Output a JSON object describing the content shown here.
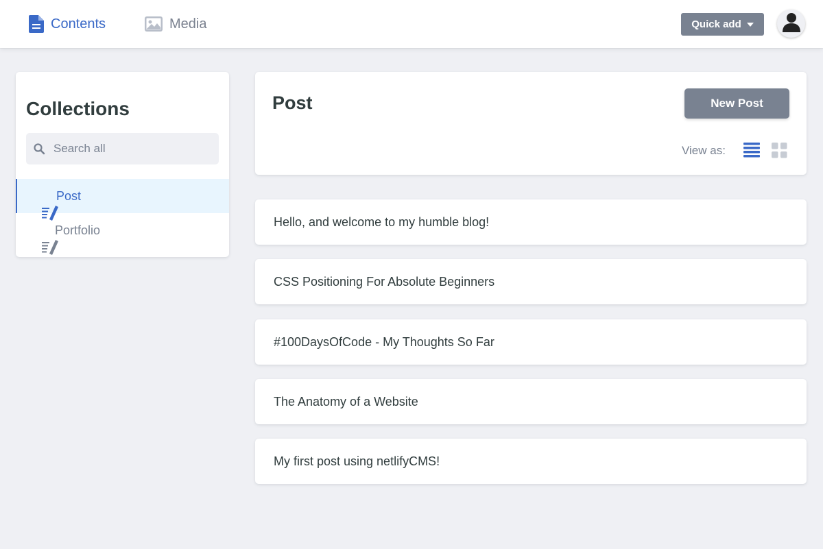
{
  "topbar": {
    "nav": [
      {
        "label": "Contents",
        "icon": "document-icon",
        "active": true
      },
      {
        "label": "Media",
        "icon": "image-icon",
        "active": false
      }
    ],
    "quick_add_label": "Quick add",
    "avatar_icon": "user-avatar-icon"
  },
  "sidebar": {
    "title": "Collections",
    "search_placeholder": "Search all",
    "collections": [
      {
        "label": "Post",
        "icon": "write-icon",
        "active": true
      },
      {
        "label": "Portfolio",
        "icon": "write-icon",
        "active": false
      }
    ]
  },
  "main": {
    "title": "Post",
    "new_button_label": "New Post",
    "view_as_label": "View as:",
    "view_modes": [
      {
        "name": "list",
        "icon": "list-icon",
        "active": true
      },
      {
        "name": "grid",
        "icon": "grid-icon",
        "active": false
      }
    ],
    "entries": [
      {
        "title": "Hello, and welcome to my humble blog!"
      },
      {
        "title": "CSS Positioning For Absolute Beginners"
      },
      {
        "title": "#100DaysOfCode - My Thoughts So Far"
      },
      {
        "title": "The Anatomy of a Website"
      },
      {
        "title": "My first post using netlifyCMS!"
      }
    ]
  },
  "colors": {
    "accent": "#3a69c7",
    "button_gray": "#798291",
    "background": "#eff0f4",
    "active_row": "#e8f5fe",
    "text": "#313d3e"
  }
}
